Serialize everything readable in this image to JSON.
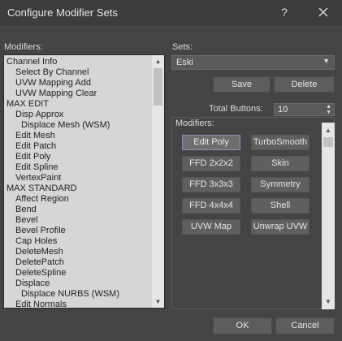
{
  "window": {
    "title": "Configure Modifier Sets",
    "help_label": "?"
  },
  "modifiers_panel": {
    "label": "Modifiers:",
    "items": [
      "Channel Info",
      "Select By Channel",
      "UVW Mapping Add",
      "UVW Mapping Clear",
      "MAX EDIT",
      "Disp Approx",
      "Displace Mesh (WSM)",
      "Edit Mesh",
      "Edit Patch",
      "Edit Poly",
      "Edit Spline",
      "VertexPaint",
      "MAX STANDARD",
      "Affect Region",
      "Bend",
      "Bevel",
      "Bevel Profile",
      "Cap Holes",
      "DeleteMesh",
      "DeletePatch",
      "DeleteSpline",
      "Displace",
      "Displace NURBS (WSM)",
      "Edit Normals"
    ],
    "indent_levels": [
      0,
      1,
      1,
      1,
      0,
      1,
      2,
      1,
      1,
      1,
      1,
      1,
      0,
      1,
      1,
      1,
      1,
      1,
      1,
      1,
      1,
      1,
      2,
      1
    ]
  },
  "sets": {
    "label": "Sets:",
    "selected": "Eski",
    "save_label": "Save",
    "delete_label": "Delete"
  },
  "total_buttons": {
    "label": "Total Buttons:",
    "value": "10"
  },
  "modifier_buttons": {
    "label": "Modifiers:",
    "buttons": [
      "Edit Poly",
      "TurboSmooth",
      "FFD 2x2x2",
      "Skin",
      "FFD 3x3x3",
      "Symmetry",
      "FFD 4x4x4",
      "Shell",
      "UVW Map",
      "Unwrap UVW"
    ]
  },
  "footer": {
    "ok_label": "OK",
    "cancel_label": "Cancel"
  },
  "colors": {
    "background": "#444444",
    "titlebar": "#3c3c3c",
    "list_background": "#d6d6d6",
    "button": "#5d5d5d",
    "selected_border": "#8a96b8"
  }
}
